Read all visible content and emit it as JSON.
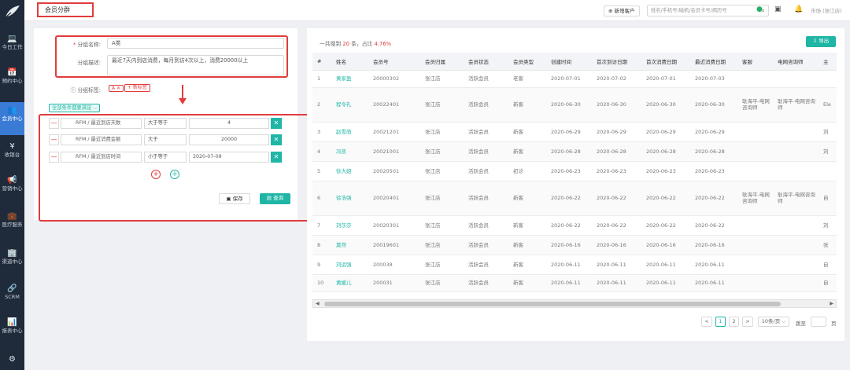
{
  "sidebar": {
    "items": [
      {
        "icon": "💻",
        "label": "今日工作"
      },
      {
        "icon": "📅",
        "label": "预约中心"
      },
      {
        "icon": "👥",
        "label": "会员中心"
      },
      {
        "icon": "¥",
        "label": "收银台"
      },
      {
        "icon": "📢",
        "label": "营销中心"
      },
      {
        "icon": "💼",
        "label": "医疗服务"
      },
      {
        "icon": "🏢",
        "label": "渠道中心"
      },
      {
        "icon": "🔗",
        "label": "SCRM"
      },
      {
        "icon": "📊",
        "label": "报表中心"
      },
      {
        "icon": "⚙",
        "label": ""
      }
    ]
  },
  "header": {
    "tab": "会员分群",
    "new_customer": "新增客户",
    "search_placeholder": "姓名/手机号/磁机/会员卡号/病历号",
    "user": "市场 (张江店)"
  },
  "form": {
    "name_label": "分组名称:",
    "name_required": "*",
    "name_value": "A类",
    "desc_label": "分组描述:",
    "desc_value": "最近7天内到店消费，每月到访4次以上，消费20000以上",
    "tag_label": "分组标签:",
    "tag_value": "A ✕",
    "new_tag": "+ 新标签",
    "cond_select": "全部条件都要满足 ⌵",
    "rows": [
      {
        "field": "RFM / 最近到店天数",
        "op": "大于等于",
        "value": "4"
      },
      {
        "field": "RFM / 最近消费金额",
        "op": "大于",
        "value": "20000"
      },
      {
        "field": "RFM / 最近到店时间",
        "op": "小于等于",
        "value": "2020-07-09"
      }
    ],
    "save": "保存",
    "query": "查询"
  },
  "stats": {
    "prefix": "一共搜到",
    "count": "20",
    "mid": "条，占比",
    "percent": "4.76%"
  },
  "export": "导出",
  "table": {
    "headers": [
      "#",
      "姓名",
      "会员号",
      "会员归属",
      "会员状态",
      "会员类型",
      "创建时间",
      "首次到访日期",
      "首次消费日期",
      "最近消费日期",
      "客服",
      "电网咨询师",
      "主"
    ],
    "rows": [
      [
        "1",
        "黄家盈",
        "20000302",
        "张江店",
        "活跃会员",
        "老客",
        "2020-07-01",
        "2020-07-02",
        "2020-07-01",
        "2020-07-03",
        "",
        "",
        ""
      ],
      [
        "2",
        "程令礼",
        "20022401",
        "张江店",
        "活跃会员",
        "新客",
        "2020-06-30",
        "2020-06-30",
        "2020-06-30",
        "2020-06-30",
        "耿海平-电网咨询师",
        "耿海平-电网咨询师",
        "Ele"
      ],
      [
        "3",
        "赵雪萌",
        "20021201",
        "张江店",
        "活跃会员",
        "新客",
        "2020-06-29",
        "2020-06-29",
        "2020-06-29",
        "2020-06-29",
        "",
        "",
        "刘"
      ],
      [
        "4",
        "冯凯",
        "20021001",
        "张江店",
        "活跃会员",
        "新客",
        "2020-06-28",
        "2020-06-28",
        "2020-06-28",
        "2020-06-28",
        "",
        "",
        "刘"
      ],
      [
        "5",
        "徐大姐",
        "20020501",
        "张江店",
        "活跃会员",
        "初诊",
        "2020-06-23",
        "2020-06-23",
        "2020-06-23",
        "2020-06-23",
        "",
        "",
        ""
      ],
      [
        "6",
        "徐浩强",
        "20020401",
        "张江店",
        "活跃会员",
        "新客",
        "2020-06-22",
        "2020-06-22",
        "2020-06-22",
        "2020-06-22",
        "耿海平-电网咨询师",
        "耿海平-电网咨询师",
        "自"
      ],
      [
        "7",
        "刘莎莎",
        "20020301",
        "张江店",
        "活跃会员",
        "新客",
        "2020-06-22",
        "2020-06-22",
        "2020-06-22",
        "2020-06-22",
        "",
        "",
        "刘"
      ],
      [
        "8",
        "莫然",
        "20019601",
        "张江店",
        "活跃会员",
        "新客",
        "2020-06-16",
        "2020-06-16",
        "2020-06-16",
        "2020-06-16",
        "",
        "",
        "张"
      ],
      [
        "9",
        "刘运强",
        "200038",
        "张江店",
        "活跃会员",
        "新客",
        "2020-06-11",
        "2020-06-11",
        "2020-06-11",
        "2020-06-11",
        "",
        "",
        "自"
      ],
      [
        "10",
        "黄媛儿",
        "200031",
        "张江店",
        "活跃会员",
        "新客",
        "2020-06-11",
        "2020-06-11",
        "2020-06-11",
        "2020-06-11",
        "",
        "",
        "自"
      ]
    ]
  },
  "pagination": {
    "prev": "<",
    "p1": "1",
    "p2": "2",
    "next": ">",
    "per_page": "10条/页 ⌵",
    "goto": "跳至",
    "page_suffix": "页"
  },
  "colors": {
    "accent": "#1fb6a6",
    "annotation": "#e23b3b",
    "sidebar": "#1f2a3a"
  }
}
